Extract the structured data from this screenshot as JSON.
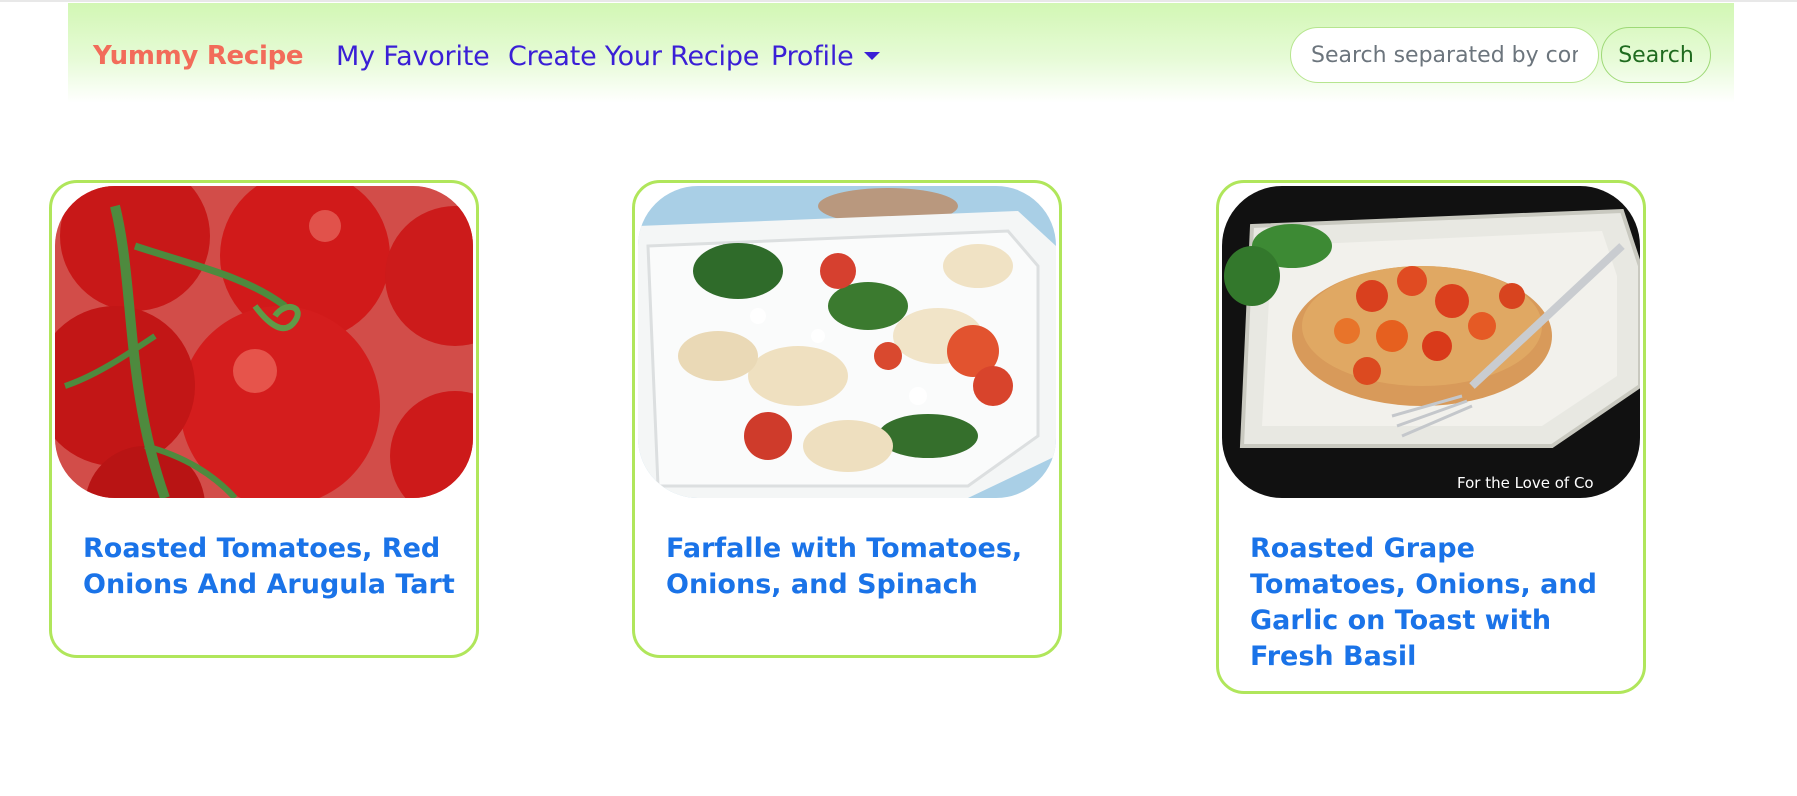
{
  "nav": {
    "brand": "Yummy Recipe",
    "links": [
      {
        "label": "My Favorite"
      },
      {
        "label": "Create Your Recipe"
      },
      {
        "label": "Profile"
      }
    ],
    "search": {
      "placeholder": "Search separated by comma",
      "button_label": "Search"
    }
  },
  "recipes": [
    {
      "title": "Roasted Tomatoes, Red Onions And Arugula Tart",
      "image": "tomatoes-on-vine-photo"
    },
    {
      "title": "Farfalle with Tomatoes, Onions, and Spinach",
      "image": "farfalle-pasta-bowl-photo"
    },
    {
      "title": "Roasted Grape Tomatoes, Onions, and Garlic on Toast with Fresh Basil",
      "image": "tomato-bruschetta-photo",
      "watermark": "For the Love of Co"
    }
  ],
  "colors": {
    "brand": "#f26c5a",
    "nav_link": "#3a1fd6",
    "card_border": "#b0e65b",
    "card_title": "#1a73e8",
    "navbar_gradient_top": "#d2f7b4"
  }
}
